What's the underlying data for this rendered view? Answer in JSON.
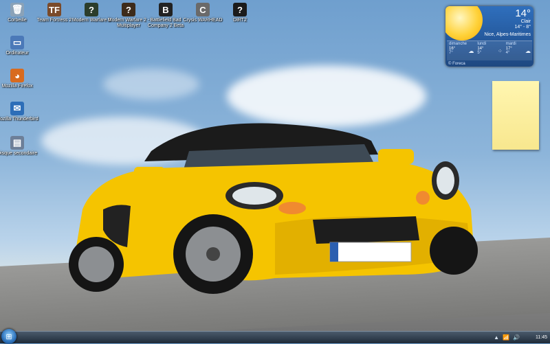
{
  "desktop": {
    "icons": [
      {
        "label": "Corbeille",
        "icon": "recycle-bin-icon",
        "color": "#8aa2b8",
        "glyph": "🗑"
      },
      {
        "label": "Team Fortress 2",
        "icon": "team-fortress-icon",
        "color": "#7a4a2a",
        "glyph": "TF"
      },
      {
        "label": "Modern Warfare 2",
        "icon": "modern-warfare-icon",
        "color": "#2b3d2b",
        "glyph": "?"
      },
      {
        "label": "Modern Warfare 2 - Multiplayer",
        "icon": "modern-warfare-mp-icon",
        "color": "#3d2b1a",
        "glyph": "?"
      },
      {
        "label": "Battlefield Bad Company 2 Beta",
        "icon": "battlefield-icon",
        "color": "#222",
        "glyph": "B"
      },
      {
        "label": "Crysis WARHEAD",
        "icon": "crysis-icon",
        "color": "#6a6a6a",
        "glyph": "C"
      },
      {
        "label": "DiRT2",
        "icon": "dirt2-icon",
        "color": "#1b1b1b",
        "glyph": "?"
      },
      {
        "label": "Ordinateur",
        "icon": "computer-icon",
        "color": "#4b79b8",
        "glyph": "▭"
      },
      {
        "label": "Mozilla Firefox",
        "icon": "firefox-icon",
        "color": "#d86b1f",
        "glyph": "◕"
      },
      {
        "label": "Mozilla Thunderbird",
        "icon": "thunderbird-icon",
        "color": "#2d6eb8",
        "glyph": "✉"
      },
      {
        "label": "Disque secondaire",
        "icon": "hard-drive-icon",
        "color": "#6d7f98",
        "glyph": "▤"
      }
    ]
  },
  "weather": {
    "temp": "14°",
    "desc": "Clair",
    "range": "14° - 8°",
    "location": "Nice, Alpes-Maritimes",
    "days": [
      {
        "name": "dimanche",
        "hi": "16°",
        "lo": "7°",
        "icon": "☁"
      },
      {
        "name": "lundi",
        "hi": "14°",
        "lo": "5°",
        "icon": "⁘"
      },
      {
        "name": "mardi",
        "hi": "17°",
        "lo": "4°",
        "icon": "☁"
      }
    ],
    "source": "© Foreca"
  },
  "taskbar": {
    "start_icon": "windows-orb-icon",
    "tray_icons": [
      "▲",
      "📶",
      "🔊"
    ],
    "time": "11:45"
  }
}
